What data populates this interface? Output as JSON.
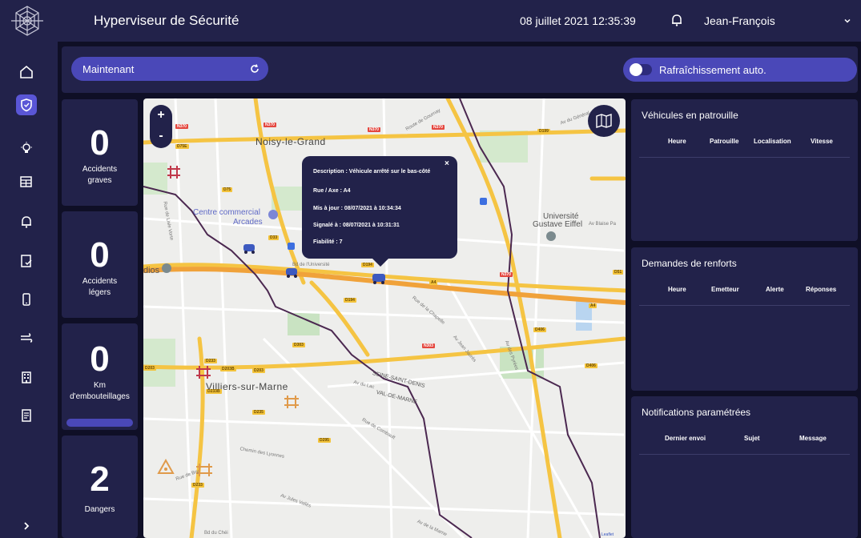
{
  "header": {
    "title": "Hyperviseur de Sécurité",
    "datetime": "08 juillet 2021 12:35:39",
    "user": "Jean-François"
  },
  "sidebar": {
    "items": [
      {
        "icon": "home-icon"
      },
      {
        "icon": "shield-icon",
        "active": true
      },
      {
        "icon": "lightbulb-icon"
      },
      {
        "icon": "table-icon"
      },
      {
        "icon": "bell-icon"
      },
      {
        "icon": "document-check-icon"
      },
      {
        "icon": "phone-icon"
      },
      {
        "icon": "wind-icon"
      },
      {
        "icon": "building-icon"
      },
      {
        "icon": "report-icon"
      }
    ],
    "expand_icon": "chevron-right-icon"
  },
  "toolbar": {
    "time_select": "Maintenant",
    "auto_refresh_label": "Rafraîchissement auto.",
    "auto_refresh_on": false
  },
  "stats": [
    {
      "value": "0",
      "label_1": "Accidents",
      "label_2": "graves"
    },
    {
      "value": "0",
      "label_1": "Accidents",
      "label_2": "légers"
    },
    {
      "value": "0",
      "label_1": "Km",
      "label_2": "d'embouteillages"
    },
    {
      "value": "2",
      "label_1": "Dangers",
      "label_2": ""
    }
  ],
  "map": {
    "zoom_in": "+",
    "zoom_out": "-",
    "attribution": "Leaflet",
    "places": {
      "noisy": "Noisy-le-Grand",
      "centre_1": "Centre commercial",
      "centre_2": "Arcades",
      "univ_1": "Université",
      "univ_2": "Gustave Eiffel",
      "villiers": "Villiers-sur-Marne",
      "seine": "SEINE-SAINT-DENIS",
      "valdemarne": "VAL-DE-MARNE",
      "dios": "dios"
    },
    "roads": {
      "n370a": "N370",
      "n370b": "N370",
      "n370c": "N370",
      "n370d": "N370",
      "n370e": "N370",
      "d75e": "D75E",
      "d75": "D75",
      "d199": "D199",
      "d33": "D33",
      "d194": "D194",
      "d194b": "D194",
      "a4": "A4",
      "a4b": "A4",
      "n303": "N303",
      "d303": "D303",
      "d406": "D406",
      "d406b": "D406",
      "d51": "D51",
      "d233": "D233",
      "d203": "D203",
      "d203b": "D203",
      "d2038": "D203B",
      "d235": "D235",
      "d295": "D295",
      "d2338": "D233B",
      "d233b": "D233"
    },
    "streets": {
      "s1": "Av du Général",
      "s2": "Route de Gournay",
      "s3": "Av Blaise Pa",
      "s4": "Bd de l'Université",
      "s5": "Rue de la Chapelle",
      "s6": "Av Jean Jaurès",
      "s7": "Av du Lac",
      "s8": "Rue de Combault",
      "s9": "Chemin des Lyonnes",
      "s10": "Av Jules Vallès",
      "s11": "Rue de Bry",
      "s12": "Av des Pyrées",
      "s13": "Bd du Chéi",
      "s14": "Av de la Marne",
      "s15": "Rue de Lisle Vorte"
    },
    "popup": {
      "description": "Description : Véhicule arrêté sur le bas-côté",
      "road": "Rue / Axe : A4",
      "updated": "Mis à jour : 08/07/2021 à 10:34:34",
      "reported": "Signalé à : 08/07/2021 à 10:31:31",
      "reliability": "Fiabilité : 7",
      "close": "×"
    }
  },
  "panels": {
    "patrol": {
      "title": "Véhicules en patrouille",
      "columns": [
        "Heure",
        "Patrouille",
        "Localisation",
        "Vitesse"
      ]
    },
    "reinforcements": {
      "title": "Demandes de renforts",
      "columns": [
        "Heure",
        "Emetteur",
        "Alerte",
        "Réponses"
      ]
    },
    "notifications": {
      "title": "Notifications paramétrées",
      "columns": [
        "Dernier envoi",
        "Sujet",
        "Message"
      ]
    }
  },
  "colors": {
    "bg": "#0f0f26",
    "panel": "#22224a",
    "accent": "#4a48b8",
    "active": "#5a56d6",
    "boundary": "#4b2850",
    "highway": "#f5c443"
  }
}
